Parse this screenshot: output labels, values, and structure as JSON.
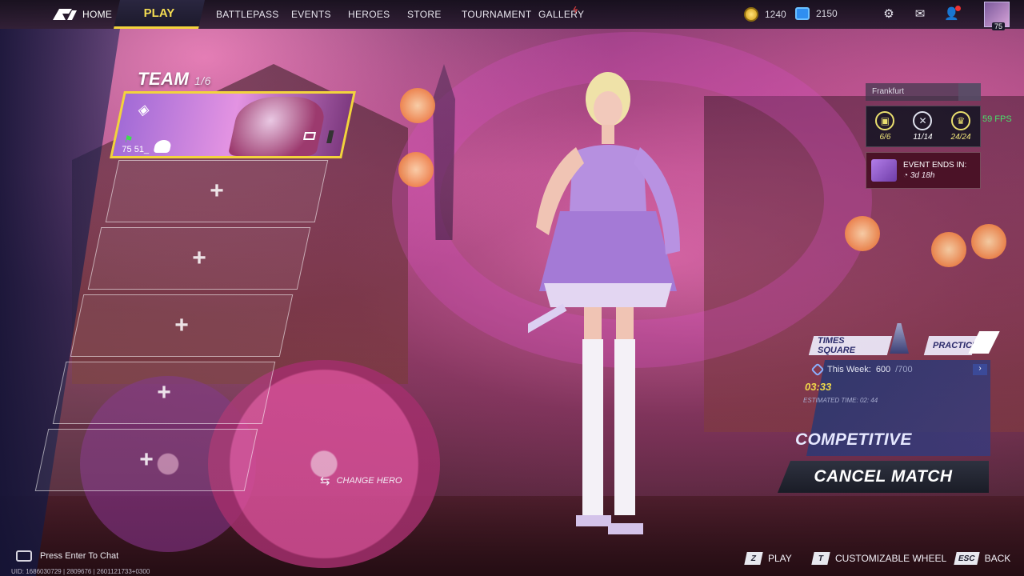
{
  "nav": {
    "home": "HOME",
    "play": "PLAY",
    "items": [
      "BATTLEPASS",
      "EVENTS",
      "HEROES",
      "STORE",
      "TOURNAMENT",
      "GALLERY"
    ],
    "coins": "1240",
    "gems": "2150",
    "avatar_level": "75"
  },
  "team": {
    "title": "TEAM",
    "count": "1/6",
    "member": {
      "level": "75",
      "name": "51_"
    }
  },
  "change_hero": "CHANGE HERO",
  "server": "Frankfurt",
  "stats": [
    {
      "icon": "daily-icon",
      "value": "6/6"
    },
    {
      "icon": "crossed-swords-icon",
      "value": "11/14"
    },
    {
      "icon": "trophy-icon",
      "value": "24/24"
    }
  ],
  "fps": "59 FPS",
  "event": {
    "label": "EVENT ENDS IN:",
    "timer": "3d 18h"
  },
  "modes": {
    "map": "TIMES SQUARE",
    "practice": "PRACTICE"
  },
  "weekly": {
    "label": "This Week:",
    "current": "600",
    "max": "/700"
  },
  "queue": {
    "timer": "03:33",
    "estimated": "ESTIMATED TIME: 02: 44"
  },
  "competitive": "COMPETITIVE",
  "cancel": "CANCEL MATCH",
  "chat": "Press Enter To Chat",
  "uid": "UID: 1686030729 | 2809676 | 2601121733+0300",
  "hints": [
    {
      "key": "Z",
      "label": "PLAY"
    },
    {
      "key": "T",
      "label": "CUSTOMIZABLE WHEEL"
    },
    {
      "key": "ESC",
      "label": "BACK"
    }
  ],
  "colors": {
    "accent": "#f2d43c",
    "fps": "#48e06a",
    "event_bg": "#46102a"
  }
}
